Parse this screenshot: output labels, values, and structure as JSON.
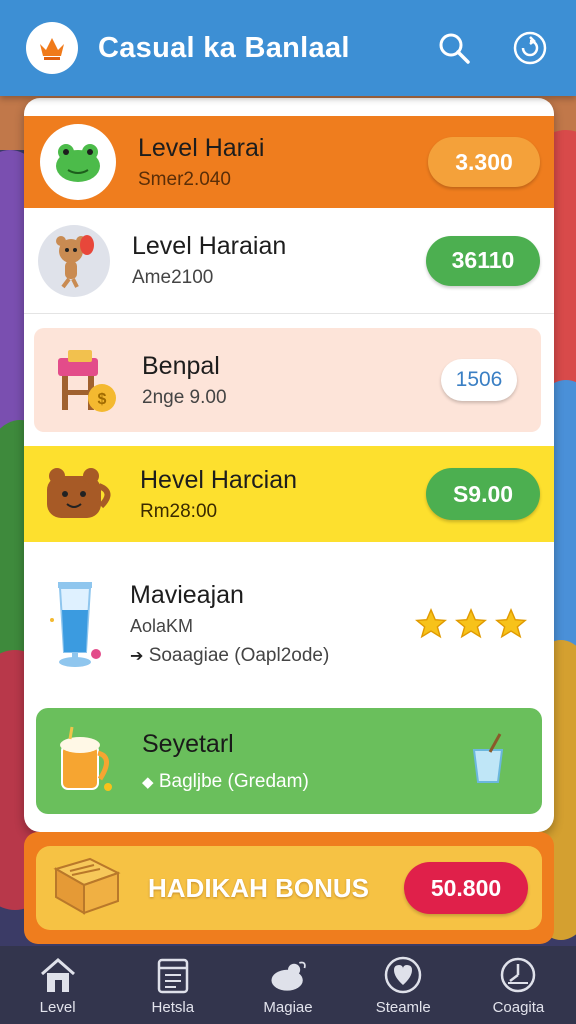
{
  "header": {
    "title": "Casual ka Banlaal",
    "logo_icon": "crown-icon",
    "search_icon": "search-icon",
    "refresh_icon": "refresh-icon"
  },
  "rows": [
    {
      "title": "Level Harai",
      "subtitle": "Smer2.040",
      "badge": "3.300",
      "badge_color": "#f4a13a",
      "icon": "frog-icon"
    },
    {
      "title": "Level Haraian",
      "subtitle": "Ame2100",
      "badge": "36110",
      "badge_color": "#4caf50",
      "icon": "teddy-bear-icon"
    },
    {
      "title": "Benpal",
      "subtitle": "2nge 9.00",
      "badge": "1506",
      "badge_color": "#ffffff",
      "icon": "stool-coin-icon"
    },
    {
      "title": "Hevel Harcian",
      "subtitle": "Rm28:00",
      "badge": "S9.00",
      "badge_color": "#4caf50",
      "icon": "bear-icon"
    },
    {
      "title": "Mavieajan",
      "subtitle": "AolaKM",
      "detail": "Soaagiae (Oapl2ode)",
      "rating": 3,
      "icon": "drink-glass-icon"
    },
    {
      "title": "Seyetarl",
      "subtitle": "Bagljbe (Gredam)",
      "icon": "beer-mug-icon",
      "right_icon": "cup-icon"
    }
  ],
  "bonus": {
    "label": "HADIKAH BONUS",
    "value": "50.800",
    "icon": "book-icon"
  },
  "nav": [
    {
      "label": "Level",
      "icon": "home-icon"
    },
    {
      "label": "Hetsla",
      "icon": "calendar-icon"
    },
    {
      "label": "Magiae",
      "icon": "bird-icon"
    },
    {
      "label": "Steamle",
      "icon": "heart-shield-icon"
    },
    {
      "label": "Coagita",
      "icon": "clock-icon"
    }
  ]
}
